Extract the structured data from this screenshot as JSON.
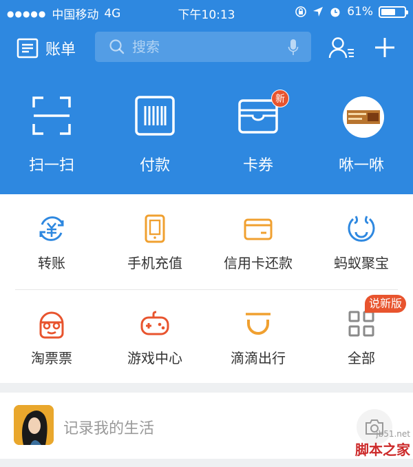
{
  "status_bar": {
    "carrier": "中国移动",
    "network": "4G",
    "time": "下午10:13",
    "battery_percent": "61%",
    "battery_level": 0.61
  },
  "header": {
    "bill_label": "账单",
    "search_placeholder": "搜索"
  },
  "quick_actions": [
    {
      "label": "扫一扫",
      "icon": "scan-icon"
    },
    {
      "label": "付款",
      "icon": "barcode-pay-icon"
    },
    {
      "label": "卡券",
      "icon": "card-wallet-icon",
      "badge": "新"
    },
    {
      "label": "咻一咻",
      "icon": "xiu-avatar-icon"
    }
  ],
  "services": [
    {
      "label": "转账",
      "icon": "transfer-icon",
      "color": "#2e88e0"
    },
    {
      "label": "手机充值",
      "icon": "phone-recharge-icon",
      "color": "#f0a030"
    },
    {
      "label": "信用卡还款",
      "icon": "credit-card-icon",
      "color": "#f0a030"
    },
    {
      "label": "蚂蚁聚宝",
      "icon": "ant-fortune-icon",
      "color": "#2e88e0"
    },
    {
      "label": "淘票票",
      "icon": "taopiaopiao-icon",
      "color": "#e8542e"
    },
    {
      "label": "游戏中心",
      "icon": "game-controller-icon",
      "color": "#e8542e"
    },
    {
      "label": "滴滴出行",
      "icon": "didi-icon",
      "color": "#f0a030"
    },
    {
      "label": "全部",
      "icon": "grid-all-icon",
      "color": "#8a8a8a"
    }
  ],
  "version_badge": "说新版",
  "life": {
    "placeholder": "记录我的生活"
  },
  "watermark": {
    "url": "jb51.net",
    "name": "脚本之家"
  },
  "colors": {
    "brand_blue": "#2e88e0",
    "badge_red": "#e8542e",
    "orange": "#f0a030"
  }
}
